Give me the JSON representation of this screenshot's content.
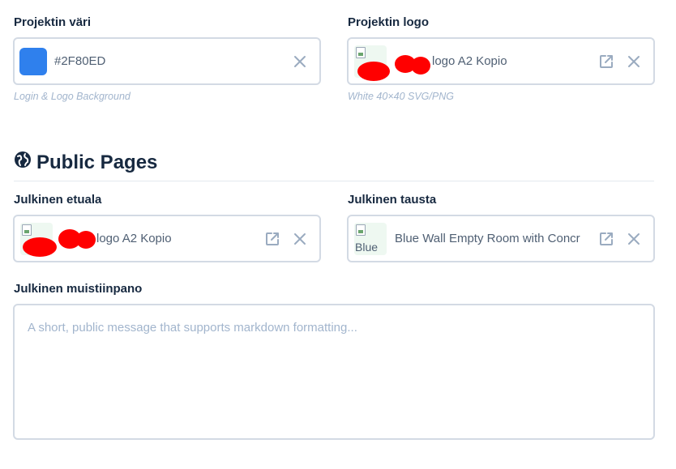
{
  "project_color": {
    "label": "Projektin väri",
    "value": "#2F80ED",
    "swatch_color": "#2F80ED",
    "hint": "Login & Logo Background"
  },
  "project_logo": {
    "label": "Projektin logo",
    "file_name": "logo A2 Kopio",
    "hint": "White 40×40 SVG/PNG"
  },
  "public_pages": {
    "title": "Public Pages",
    "icon": "globe-icon",
    "foreground": {
      "label": "Julkinen etuala",
      "file_name": "logo A2 Kopio"
    },
    "background": {
      "label": "Julkinen tausta",
      "file_name": "Blue Wall Empty Room with Concr",
      "thumb_alt": "Blue"
    },
    "note": {
      "label": "Julkinen muistiinpano",
      "placeholder": "A short, public message that supports markdown formatting..."
    }
  },
  "icons": {
    "clear": "close-icon",
    "open": "external-link-icon",
    "broken_image": "broken-image-icon"
  }
}
